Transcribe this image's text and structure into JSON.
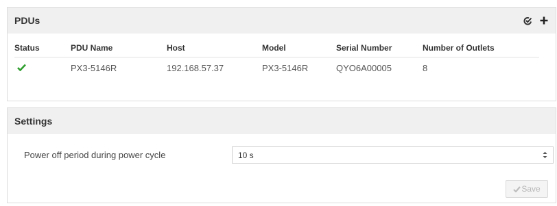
{
  "pdus": {
    "title": "PDUs",
    "icons": {
      "edit": "edit-check-icon",
      "add": "plus-icon"
    },
    "columns": [
      "Status",
      "PDU Name",
      "Host",
      "Model",
      "Serial Number",
      "Number of Outlets"
    ],
    "rows": [
      {
        "status_icon": "checkmark-icon",
        "status_color": "#2e9e2e",
        "name": "PX3-5146R",
        "host": "192.168.57.37",
        "model": "PX3-5146R",
        "serial": "QYO6A00005",
        "outlets": "8"
      }
    ]
  },
  "settings": {
    "title": "Settings",
    "power_off_label": "Power off period during power cycle",
    "power_off_value": "10 s",
    "save_label": "Save"
  }
}
